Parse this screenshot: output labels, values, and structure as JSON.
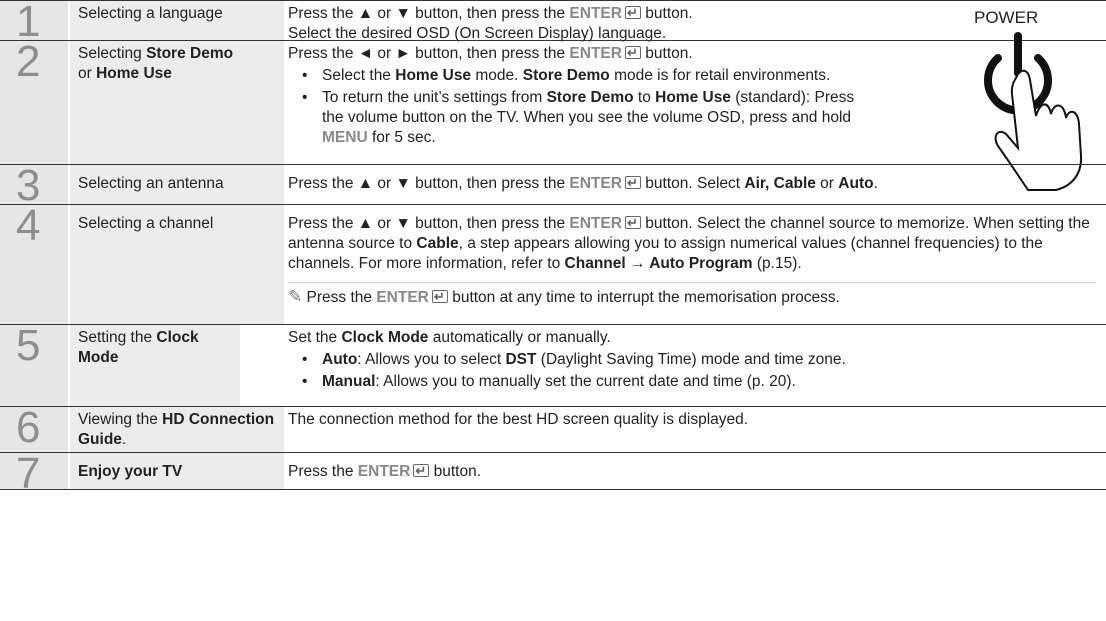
{
  "power_label": "POWER",
  "steps": [
    {
      "num": "1",
      "label": "Selecting a language",
      "line1_a": "Press the ▲ or ▼ button, then press the ",
      "enter": "ENTER",
      "line1_b": " button.",
      "line2": "Select the desired OSD (On Screen Display) language."
    },
    {
      "num": "2",
      "label_a": "Selecting ",
      "label_b": "Store Demo",
      "label_c": "or ",
      "label_d": "Home Use",
      "line1_a": "Press the ◄ or ► button, then press the ",
      "enter": "ENTER",
      "line1_b": " button.",
      "b1_a": "Select the ",
      "b1_b": "Home Use",
      "b1_c": " mode. ",
      "b1_d": "Store Demo",
      "b1_e": " mode is for retail environments.",
      "b2_a": "To return the unit’s settings from ",
      "b2_b": "Store Demo",
      "b2_c": " to ",
      "b2_d": "Home Use",
      "b2_e": " (standard): Press the volume button on the TV. When you see the volume OSD, press and hold ",
      "b2_f": "MENU",
      "b2_g": " for 5 sec."
    },
    {
      "num": "3",
      "label": "Selecting an antenna",
      "a": "Press the ▲ or ▼ button, then press the ",
      "enter": "ENTER",
      "b": " button. Select ",
      "c": "Air, Cable",
      "d": " or ",
      "e": "Auto",
      "f": "."
    },
    {
      "num": "4",
      "label": "Selecting a channel",
      "a": "Press the ▲ or ▼ button, then press the ",
      "enter": "ENTER",
      "b": " button. Select the channel source to memorize. When setting the antenna source to ",
      "c": "Cable",
      "d": ", a step appears allowing you to assign numerical values (channel frequencies) to the channels. For more information, refer to ",
      "e": "Channel → Auto Program",
      "f": " (p.15).",
      "note_a": " Press the ",
      "note_enter": "ENTER",
      "note_b": " button at any time to interrupt the memorisation process."
    },
    {
      "num": "5",
      "label_a": "Setting the ",
      "label_b": "Clock Mode",
      "a": "Set the ",
      "b": "Clock Mode",
      "c": " automatically or manually.",
      "b1_a": "Auto",
      "b1_b": ": Allows you to select ",
      "b1_c": "DST",
      "b1_d": " (Daylight Saving Time) mode and time zone.",
      "b2_a": "Manual",
      "b2_b": ": Allows you to manually set the current date and time (p. 20)."
    },
    {
      "num": "6",
      "label_a": "Viewing the ",
      "label_b": "HD Connection Guide",
      "label_c": ".",
      "text": "The connection method for the best HD screen quality is displayed."
    },
    {
      "num": "7",
      "label": "Enjoy your TV",
      "a": "Press the ",
      "enter": "ENTER",
      "b": " button."
    }
  ]
}
